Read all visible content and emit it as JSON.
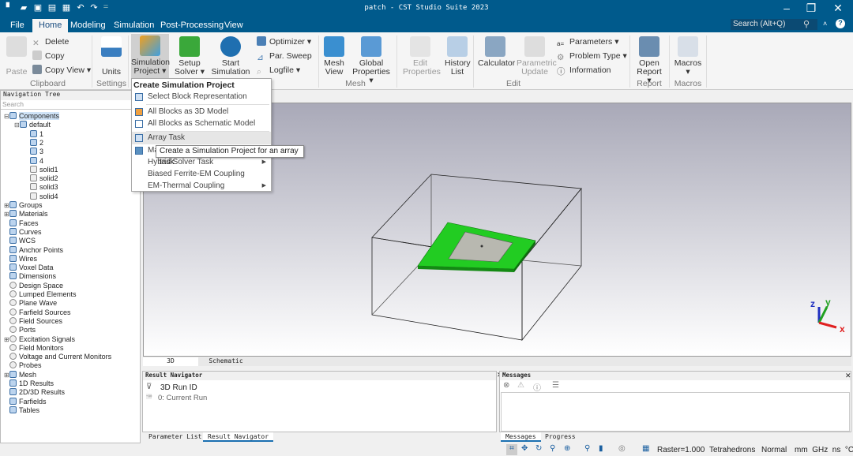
{
  "window": {
    "title": "patch - CST Studio Suite 2023",
    "controls": [
      "minimize",
      "restore",
      "close"
    ]
  },
  "quick_access": [
    "new-icon",
    "open-icon",
    "save-icon",
    "save-all-icon",
    "print-icon",
    "undo-icon",
    "redo-icon",
    "customize-icon"
  ],
  "menu_tabs": [
    {
      "label": "File"
    },
    {
      "label": "Home",
      "active": true
    },
    {
      "label": "Modeling"
    },
    {
      "label": "Simulation"
    },
    {
      "label": "Post-Processing"
    },
    {
      "label": "View"
    }
  ],
  "search": {
    "placeholder": "Search (Alt+Q)"
  },
  "ribbon": {
    "paste": "Paste",
    "delete": "Delete",
    "copy": "Copy",
    "copy_view": "Copy View",
    "clipboard": "Clipboard",
    "units": "Units",
    "settings": "Settings",
    "sim_project_1": "Simulation",
    "sim_project_2": "Project",
    "setup_solver_1": "Setup",
    "setup_solver_2": "Solver",
    "start_sim_1": "Start",
    "start_sim_2": "Simulation",
    "optimizer": "Optimizer",
    "par_sweep": "Par. Sweep",
    "logfile": "Logfile",
    "mesh_view_1": "Mesh",
    "mesh_view_2": "View",
    "global_props_1": "Global",
    "global_props_2": "Properties",
    "mesh": "Mesh",
    "edit_props_1": "Edit",
    "edit_props_2": "Properties",
    "history_1": "History",
    "history_2": "List",
    "calculator": "Calculator",
    "param_update_1": "Parametric",
    "param_update_2": "Update",
    "parameters": "Parameters",
    "problem_type": "Problem Type",
    "information": "Information",
    "edit": "Edit",
    "open_report_1": "Open",
    "open_report_2": "Report",
    "report": "Report",
    "macros": "Macros",
    "macros_group": "Macros"
  },
  "dropdown": {
    "header": "Create Simulation Project",
    "items": [
      {
        "label": "Select Block Representation"
      },
      {
        "label": "All Blocks as 3D Model"
      },
      {
        "label": "All Blocks as Schematic Model"
      },
      {
        "label": "Array Task",
        "hovered": true
      },
      {
        "label": "Ma"
      },
      {
        "label": "Hybrid Solver Task",
        "submenu": true
      },
      {
        "label": "Biased Ferrite-EM Coupling"
      },
      {
        "label": "EM-Thermal Coupling",
        "submenu": true
      }
    ],
    "tooltip": "Create a Simulation Project for an array task"
  },
  "nav": {
    "title": "Navigation Tree",
    "search_placeholder": "Search",
    "items": [
      "Components",
      "default",
      "1",
      "2",
      "3",
      "4",
      "solid1",
      "solid2",
      "solid3",
      "solid4",
      "Groups",
      "Materials",
      "Faces",
      "Curves",
      "WCS",
      "Anchor Points",
      "Wires",
      "Voxel Data",
      "Dimensions",
      "Design Space",
      "Lumped Elements",
      "Plane Wave",
      "Farfield Sources",
      "Field Sources",
      "Ports",
      "Excitation Signals",
      "Field Monitors",
      "Voltage and Current Monitors",
      "Probes",
      "Mesh",
      "1D Results",
      "2D/3D Results",
      "Farfields",
      "Tables"
    ]
  },
  "view_tabs": [
    "3D",
    "Schematic"
  ],
  "axes": {
    "x": "x",
    "y": "y",
    "z": "z",
    "x_color": "#e02020",
    "y_color": "#20a020",
    "z_color": "#2030c0"
  },
  "model_colors": {
    "substrate": "#22cc22",
    "patch": "#b8b8b0"
  },
  "result_nav": {
    "title": "Result Navigator",
    "col": "3D Run ID",
    "row": "0: Current Run",
    "tabs": [
      "Parameter List",
      "Result Navigator"
    ]
  },
  "messages": {
    "title": "Messages",
    "tabs": [
      "Messages",
      "Progress"
    ]
  },
  "status": {
    "raster": "Raster=1.000",
    "mesh": "Tetrahedrons",
    "mode": "Normal",
    "units": "mm  GHz  ns  °C"
  }
}
